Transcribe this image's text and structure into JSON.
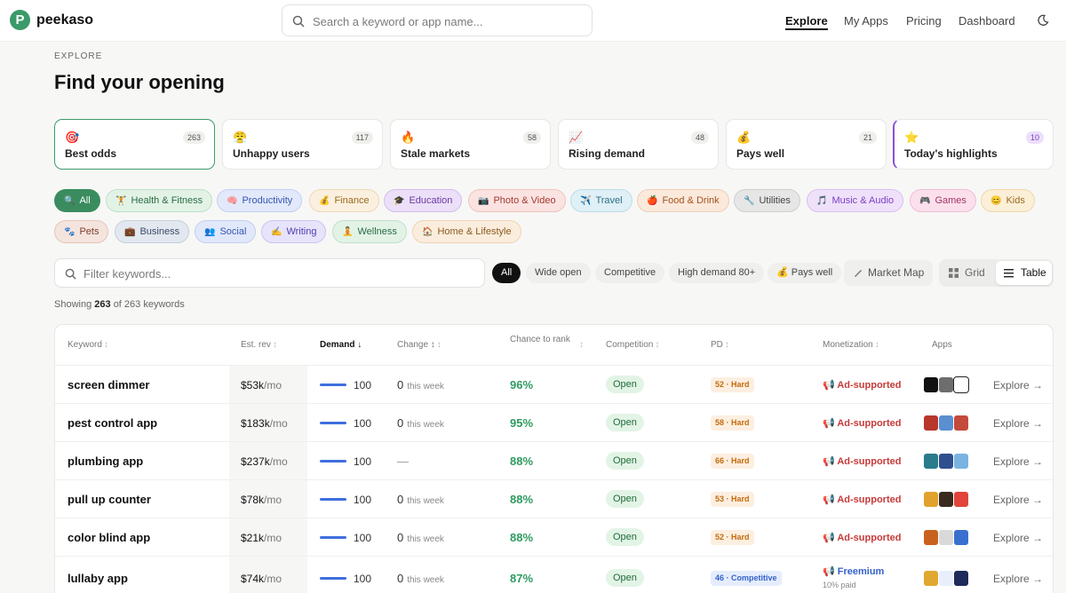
{
  "nav": {
    "brand": "peekaso",
    "logo_letter": "P",
    "search_placeholder": "Search a keyword or app name...",
    "links": [
      "Explore",
      "My Apps",
      "Pricing",
      "Dashboard"
    ]
  },
  "header": {
    "eyebrow": "EXPLORE",
    "title": "Find your opening"
  },
  "cards": [
    {
      "emoji": "🎯",
      "label": "Best odds",
      "count": "263"
    },
    {
      "emoji": "😤",
      "label": "Unhappy users",
      "count": "117"
    },
    {
      "emoji": "🔥",
      "label": "Stale markets",
      "count": "58"
    },
    {
      "emoji": "📈",
      "label": "Rising demand",
      "count": "48"
    },
    {
      "emoji": "💰",
      "label": "Pays well",
      "count": "21"
    },
    {
      "emoji": "⭐",
      "label": "Today's highlights",
      "count": "10"
    }
  ],
  "categories": [
    {
      "emoji": "🔍",
      "label": "All"
    },
    {
      "emoji": "🏋",
      "label": "Health & Fitness"
    },
    {
      "emoji": "🧠",
      "label": "Productivity"
    },
    {
      "emoji": "💰",
      "label": "Finance"
    },
    {
      "emoji": "🎓",
      "label": "Education"
    },
    {
      "emoji": "📷",
      "label": "Photo & Video"
    },
    {
      "emoji": "✈️",
      "label": "Travel"
    },
    {
      "emoji": "🍎",
      "label": "Food & Drink"
    },
    {
      "emoji": "🔧",
      "label": "Utilities"
    },
    {
      "emoji": "🎵",
      "label": "Music & Audio"
    },
    {
      "emoji": "🎮",
      "label": "Games"
    },
    {
      "emoji": "😊",
      "label": "Kids"
    },
    {
      "emoji": "🐾",
      "label": "Pets"
    },
    {
      "emoji": "💼",
      "label": "Business"
    },
    {
      "emoji": "👥",
      "label": "Social"
    },
    {
      "emoji": "✍️",
      "label": "Writing"
    },
    {
      "emoji": "🧘",
      "label": "Wellness"
    },
    {
      "emoji": "🏠",
      "label": "Home & Lifestyle"
    }
  ],
  "filter": {
    "placeholder": "Filter keywords...",
    "segments": [
      "All",
      "Wide open",
      "Competitive",
      "High demand 80+",
      "💰 Pays well"
    ],
    "market_map": "Market Map",
    "view_grid": "Grid",
    "view_table": "Table"
  },
  "showing": {
    "prefix": "Showing",
    "count": "263",
    "suffix": "of 263 keywords"
  },
  "table": {
    "headers": [
      "Keyword",
      "Est. rev",
      "Demand",
      "Change",
      "Chance to rank",
      "Competition",
      "PD",
      "Monetization",
      "Apps"
    ],
    "rows": [
      {
        "keyword": "screen dimmer",
        "rev": "$53k",
        "unit": "/mo",
        "demand": "100",
        "change": "0",
        "change_label": "this week",
        "chance": "96%",
        "competition": "Open",
        "pd": "52 · Hard",
        "monetization": "📢 Ad-supported",
        "mon_sub": "",
        "explore": "Explore →"
      },
      {
        "keyword": "pest control app",
        "rev": "$183k",
        "unit": "/mo",
        "demand": "100",
        "change": "0",
        "change_label": "this week",
        "chance": "95%",
        "competition": "Open",
        "pd": "58 · Hard",
        "monetization": "📢 Ad-supported",
        "mon_sub": "",
        "explore": "Explore →"
      },
      {
        "keyword": "plumbing app",
        "rev": "$237k",
        "unit": "/mo",
        "demand": "100",
        "change": "—",
        "change_label": "",
        "chance": "88%",
        "competition": "Open",
        "pd": "66 · Hard",
        "monetization": "📢 Ad-supported",
        "mon_sub": "",
        "explore": "Explore →"
      },
      {
        "keyword": "pull up counter",
        "rev": "$78k",
        "unit": "/mo",
        "demand": "100",
        "change": "0",
        "change_label": "this week",
        "chance": "88%",
        "competition": "Open",
        "pd": "53 · Hard",
        "monetization": "📢 Ad-supported",
        "mon_sub": "",
        "explore": "Explore →"
      },
      {
        "keyword": "color blind app",
        "rev": "$21k",
        "unit": "/mo",
        "demand": "100",
        "change": "0",
        "change_label": "this week",
        "chance": "88%",
        "competition": "Open",
        "pd": "52 · Hard",
        "monetization": "📢 Ad-supported",
        "mon_sub": "",
        "explore": "Explore →"
      },
      {
        "keyword": "lullaby app",
        "rev": "$74k",
        "unit": "/mo",
        "demand": "100",
        "change": "0",
        "change_label": "this week",
        "chance": "87%",
        "competition": "Open",
        "pd": "46 · Competitive",
        "monetization": "📢 Freemium",
        "mon_sub": "10% paid",
        "explore": "Explore →"
      }
    ]
  },
  "colors": {
    "brand": "#3a9a69",
    "demand_bar": "#3e6fe0",
    "chance": "#2e9a5f",
    "ad_supported": "#c63a3a",
    "freemium": "#3561c9"
  }
}
